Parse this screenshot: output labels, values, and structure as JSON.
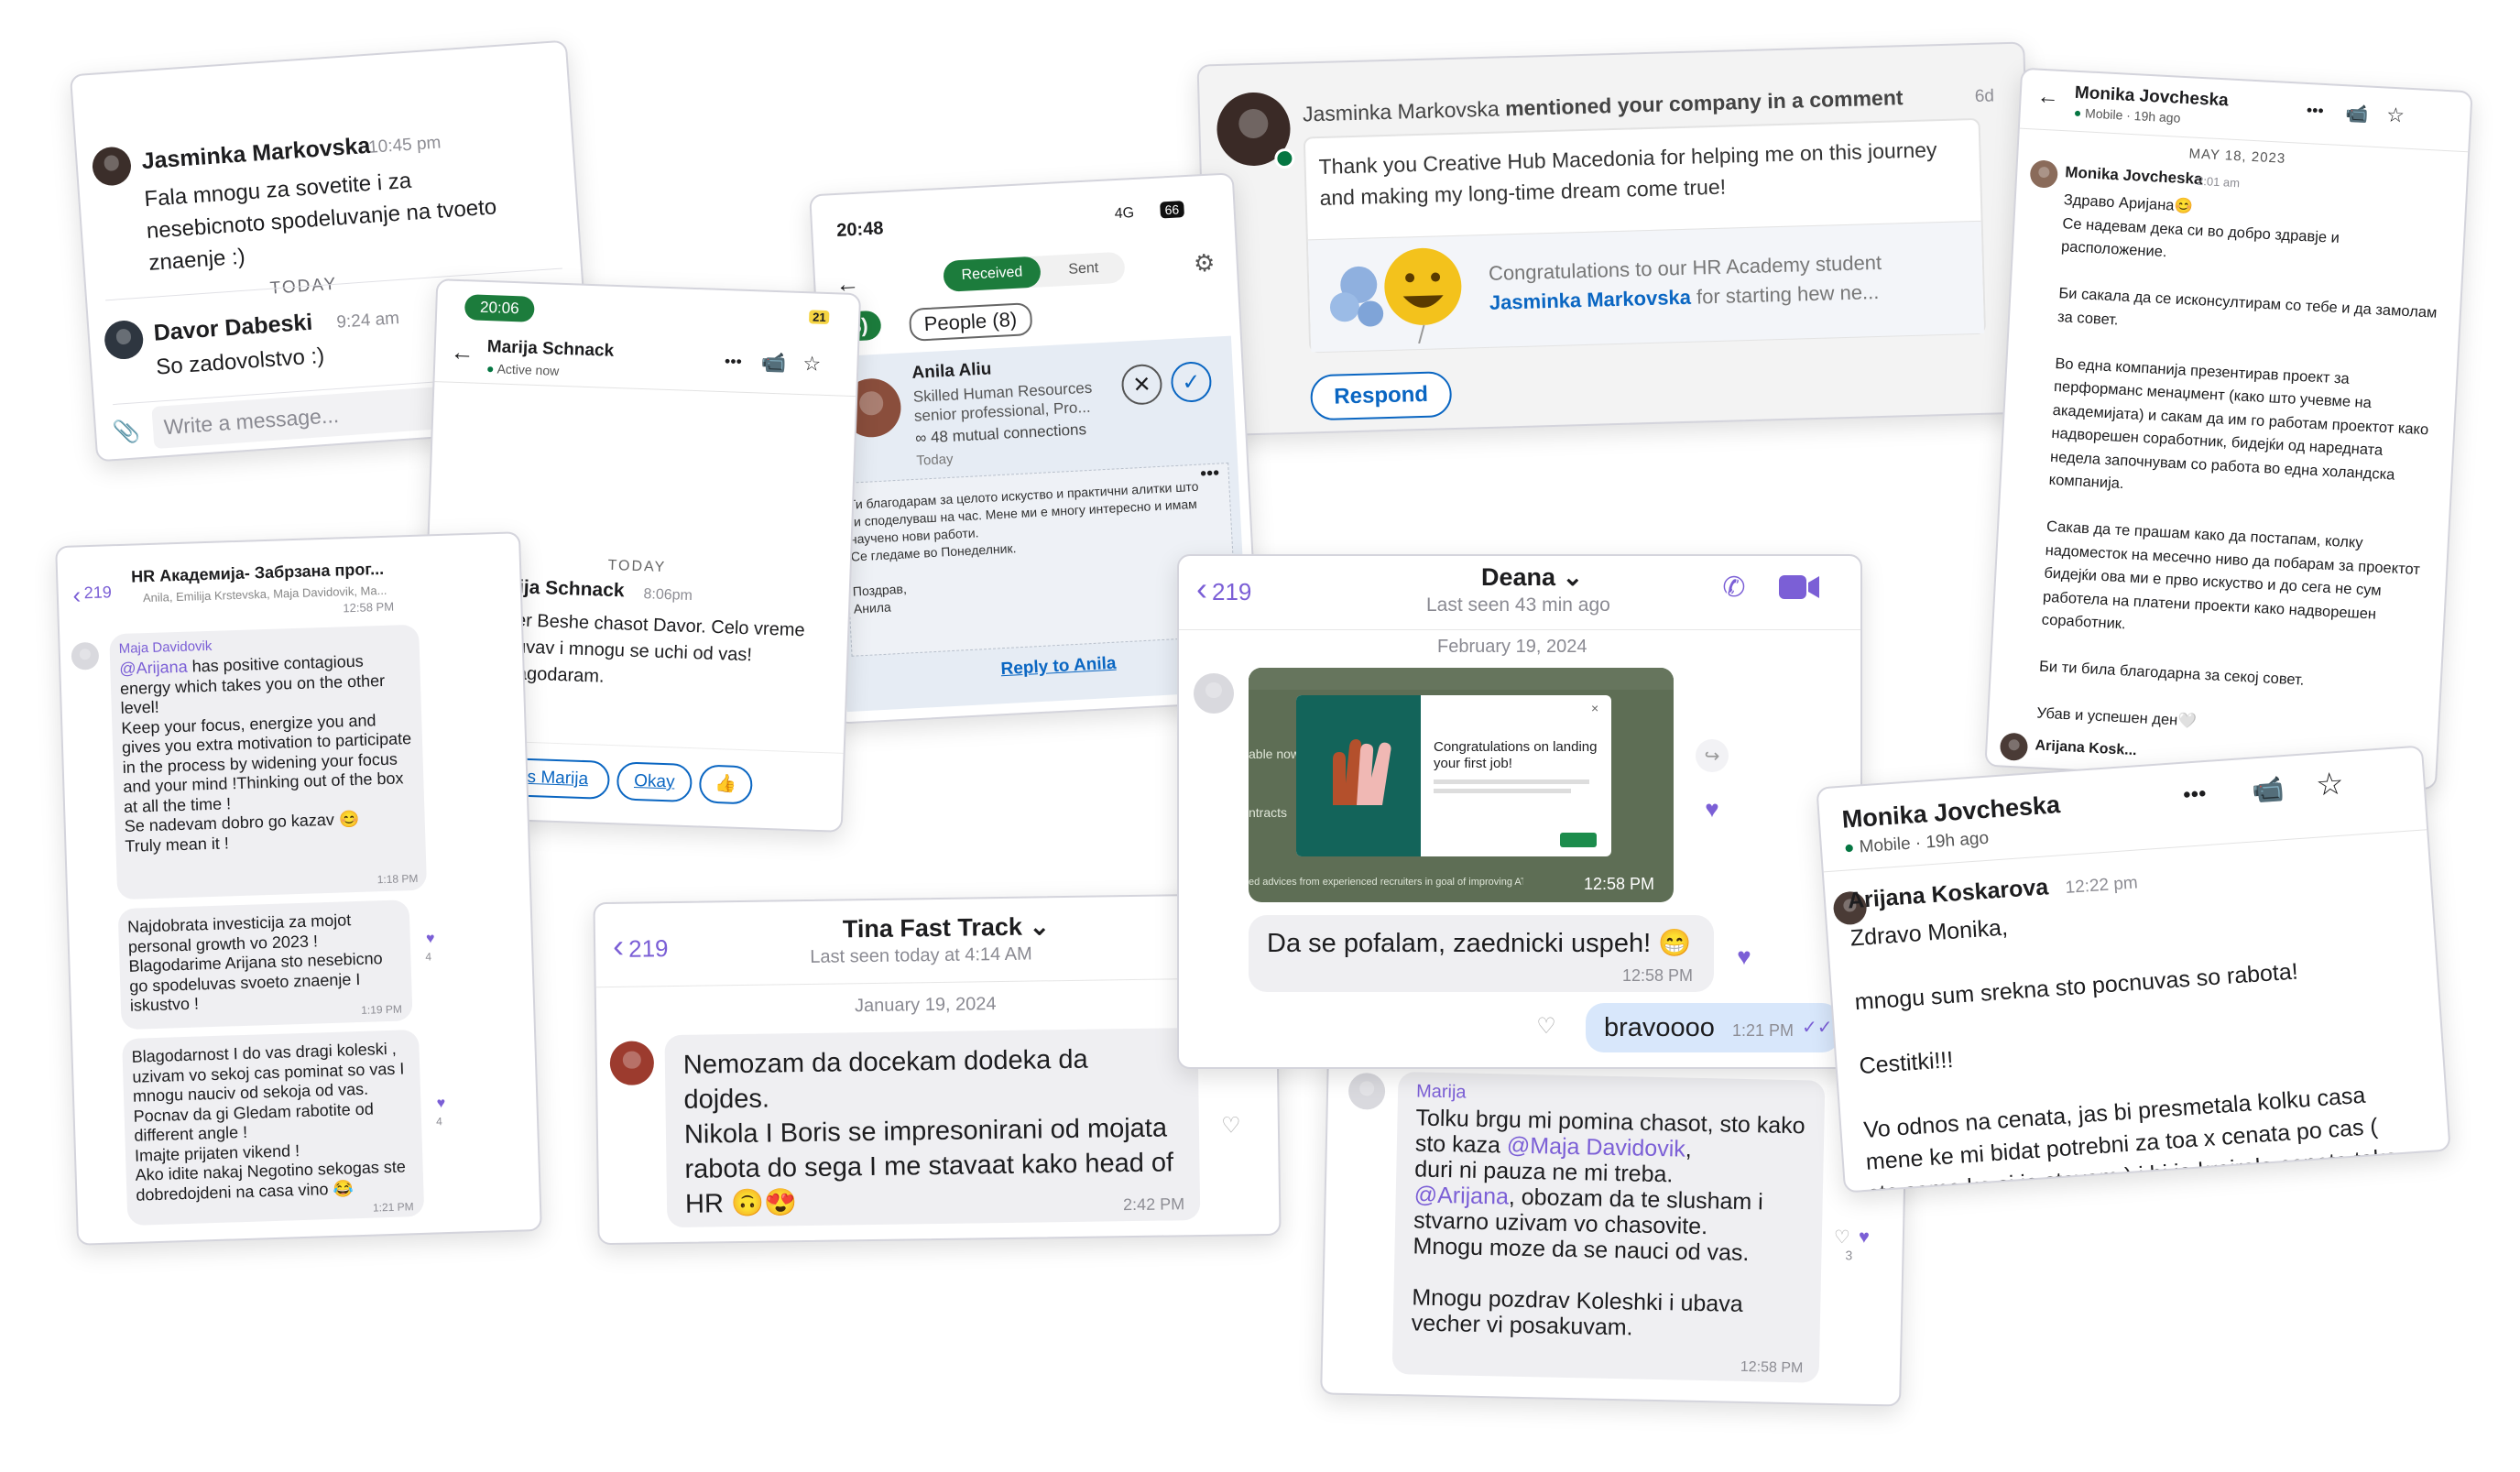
{
  "c1": {
    "name": "Jasminka Markovska",
    "time": "10:45 pm",
    "message": "Fala mnogu za sovetite i za nesebicnoto spodeluvanje na tvoeto znaenje :)",
    "divider": "TODAY",
    "name2": "Davor Dabeski",
    "time2": "9:24 am",
    "message2": "So zadovolstvo :)",
    "input_placeholder": "Write a message..."
  },
  "c2": {
    "status_time": "20:06",
    "battery": "21",
    "name": "Marija Schnack",
    "status": "Active now",
    "divider": "TODAY",
    "msg_name": "Marija Schnack",
    "msg_time": "8:06pm",
    "message": "Super Beshe chasot Davor. Celo vreme pishuvav i mnogu se uchi od vas!\nVi blagodaram.",
    "quick1": "Thanks Marija",
    "quick2": "Okay",
    "quick3": "👍"
  },
  "c3": {
    "status_time": "20:48",
    "network": "4G",
    "battery": "66",
    "tab_received": "Received",
    "tab_sent": "Sent",
    "pill1": "(8)",
    "pill2": "People (8)",
    "name": "Anila Aliu",
    "headline": "Skilled Human Resources senior professional, Pro...",
    "mutual": "48 mutual connections",
    "when": "Today",
    "message": "Ти благодарам за целото искуство и практични алитки што ги споделуваш на час. Мене ми е многу интересно и имам научено нови работи.\nСе гледаме во Понеделник.\n\nПоздрав,\nАнила",
    "reply_link": "Reply to Anila"
  },
  "c4": {
    "name": "Jasminka Markovska",
    "action": "mentioned your company in a comment",
    "age": "6d",
    "comment": "Thank you Creative Hub Macedonia for helping me on this journey and making my long-time dream come true!",
    "post_prefix": "Congratulations to our HR Academy student",
    "post_name": "Jasminka Markovska",
    "post_suffix": "for starting hew ne...",
    "respond": "Respond"
  },
  "c5": {
    "name": "Monika Jovcheska",
    "status": "Mobile",
    "age": "19h ago",
    "date": "MAY 18, 2023",
    "msg_name": "Monika Jovcheska",
    "msg_time": "2:01 am",
    "message": "Здраво Аријана😊\nСе надевам дека си во добро здравје и расположение.\n\nБи сакала да се исконсултирам со тебе и да замолам за совет.\n\nВо една компанија презентирав проект за перформанс менаџмент (како што учевме на академијата) и сакам да им го работам проектот како надворешен соработник, бидејќи од наредната недела започнувам со работа во една холандска компанија.\n\nСакав да те прашам како да постапам, колку надоместок на месечно ниво да побарам за проектот бидејќи ова ми е прво искуство и до сега не сум работела на платени проекти како надворешен соработник.\n\nБи ти била благодарна за секој совет.\n\nУбав и успешен ден🤍",
    "cut_name": "Arijana Kosk..."
  },
  "c6": {
    "back": "219",
    "title": "HR Академија- Забрзана прог...",
    "members": "Anila, Emilija Krstevska, Maja Davidovik, Ma...",
    "top_time": "12:58 PM",
    "m1_name": "Maja Davidovik",
    "m1_mention": "@Arijana",
    "m1_text": " has  positive contagious energy which takes you on the other level!\nKeep your focus, energize you and gives you extra motivation to participate in the process by widening your focus and your mind !Thinking out of the box at all the time !\nSe nadevam dobro go kazav 😊\nTruly mean it !",
    "m1_time": "1:18 PM",
    "m2_text": "Najdobrata investicija za mojot personal growth vo 2023 !\nBlagodarime Arijana sto nesebicno go spodeluvas svoeto znaenje I iskustvo !",
    "m2_time": "1:19 PM",
    "m2_likes": "4",
    "m3_text": "Blagodarnost I do vas dragi koleski , uzivam vo sekoj cas pominat so vas I mnogu nauciv od sekoja od vas.\nPocnav da gi Gledam rabotite od different angle !\nImajte prijaten vikend !\nAko idite nakaj Negotino sekogas ste dobredojdeni na casa vino 😂",
    "m3_time": "1:21 PM",
    "m3_likes": "4"
  },
  "c7": {
    "back": "219",
    "title": "Tina Fast Track",
    "status": "Last seen today at 4:14 AM",
    "date": "January 19, 2024",
    "message": "Nemozam da docekam dodeka da dojdes.\nNikola I Boris se impresonirani od mojata rabota do sega I me stavaat kako head of HR 🙃😍",
    "time": "2:42 PM"
  },
  "c8": {
    "back": "219",
    "title": "Deana",
    "status": "Last seen 43 min ago",
    "date": "February 19, 2024",
    "img_caption": "Congratulations on landing your first job!",
    "img_footer": "ed advices from experienced recruiters in goal of improving ATS system",
    "img_side1": "able now:",
    "img_side2": "ntracts",
    "img_time": "12:58 PM",
    "message": "Da se pofalam, zaednicki uspeh! 😁",
    "time": "12:58 PM",
    "reply": "bravoooo",
    "reply_time": "1:21 PM"
  },
  "c9": {
    "name": "Marija",
    "message_a": "Tolku brgu mi pomina chasot, sto kako sto kaza ",
    "mention1": "@Maja Davidovik",
    "message_b": ",\nduri ni pauza ne mi treba.\n",
    "mention2": "@Arijana",
    "message_c": ", obozam da te slusham i stvarno uzivam vo chasovite.\nMnogu moze da se nauci od vas.\n\nMnogu pozdrav Koleshki i ubava vecher vi posakuvam.",
    "time": "12:58 PM",
    "likes": "3"
  },
  "c10": {
    "name": "Monika Jovcheska",
    "status": "Mobile",
    "age": "19h ago",
    "msg_name": "Arijana Koskarova",
    "msg_time": "12:22 pm",
    "message": "Zdravo Monika,\n\nmnogu sum srekna sto pocnuvas so rabota!\n\nCestitki!!!\n\nVo odnos na cenata, jas bi presmetala kolku casa mene ke mi bidat potrebni za toa x cenata po cas ( sto sama ke si ja stavam ) i bi ja kreirala cenata taka."
  },
  "colors": {
    "linkedin_blue": "#0a66c2",
    "viber_purple": "#7b5fd6",
    "online_green": "#057642"
  }
}
